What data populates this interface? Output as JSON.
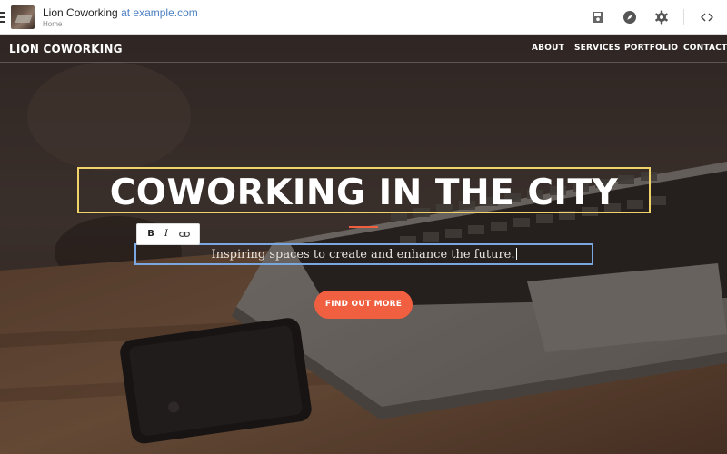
{
  "editor": {
    "site_name": "Lion Coworking",
    "at_domain": "at example.com",
    "page_name": "Home",
    "icons": [
      "menu-icon",
      "save-icon",
      "compass-icon",
      "gear-icon",
      "code-icon"
    ]
  },
  "site": {
    "brand": "LION COWORKING",
    "nav": [
      "ABOUT",
      "SERVICES",
      "PORTFOLIO",
      "CONTACT"
    ]
  },
  "hero": {
    "headline": "COWORKING IN THE CITY",
    "subtitle": "Inspiring spaces to create and enhance the future.",
    "cta": "FIND OUT MORE"
  },
  "format_toolbar": {
    "bold": "B",
    "italic": "I",
    "link_icon": "link-icon"
  },
  "colors": {
    "accent": "#f05f40",
    "headline_outline": "#f1d36b",
    "subtitle_outline": "#7ba7e0",
    "link_blue": "#4a7fc1"
  }
}
